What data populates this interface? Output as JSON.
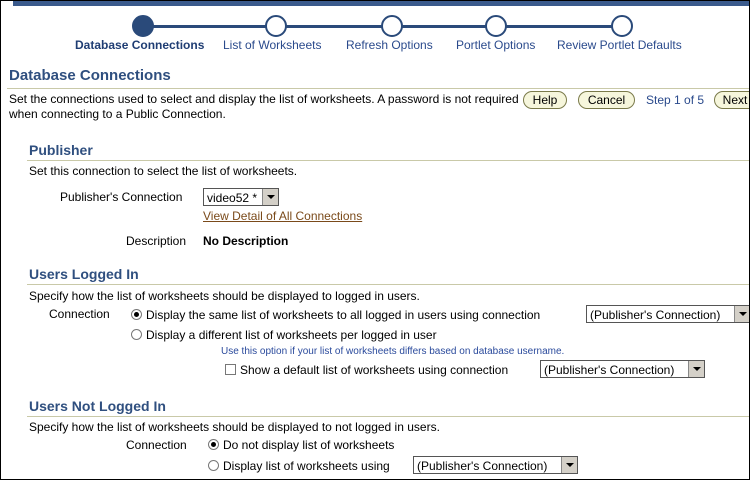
{
  "train": {
    "steps": [
      {
        "label": "Database Connections",
        "active": true
      },
      {
        "label": "List of Worksheets",
        "active": false
      },
      {
        "label": "Refresh Options",
        "active": false
      },
      {
        "label": "Portlet Options",
        "active": false
      },
      {
        "label": "Review Portlet Defaults",
        "active": false
      }
    ]
  },
  "page": {
    "title": "Database Connections",
    "description": "Set the connections used to select and display the list of worksheets. A password is not required when connecting to a Public Connection.",
    "help_label": "Help",
    "cancel_label": "Cancel",
    "step_indicator": "Step 1 of 5",
    "next_label": "Next"
  },
  "publisher": {
    "title": "Publisher",
    "description": "Set this connection to select the list of worksheets.",
    "connection_label": "Publisher's Connection",
    "connection_value": "video52 *",
    "view_detail_link": "View Detail of All Connections",
    "description_label": "Description",
    "description_value": "No Description"
  },
  "logged_in": {
    "title": "Users Logged In",
    "description": "Specify how the list of worksheets should be displayed to logged in users.",
    "connection_label": "Connection",
    "option_same": "Display the same list of worksheets to all logged in users using connection",
    "option_same_select": "(Publisher's Connection)",
    "option_different": "Display a different list of worksheets per logged in user",
    "hint": "Use this option if your list of worksheets differs based on database username.",
    "show_default_label": "Show a default list of worksheets using connection",
    "show_default_select": "(Publisher's Connection)"
  },
  "not_logged_in": {
    "title": "Users Not Logged In",
    "description": "Specify how the list of worksheets should be displayed to not logged in users.",
    "connection_label": "Connection",
    "option_none": "Do not display list of worksheets",
    "option_using": "Display list of worksheets using",
    "option_using_select": "(Publisher's Connection)"
  }
}
